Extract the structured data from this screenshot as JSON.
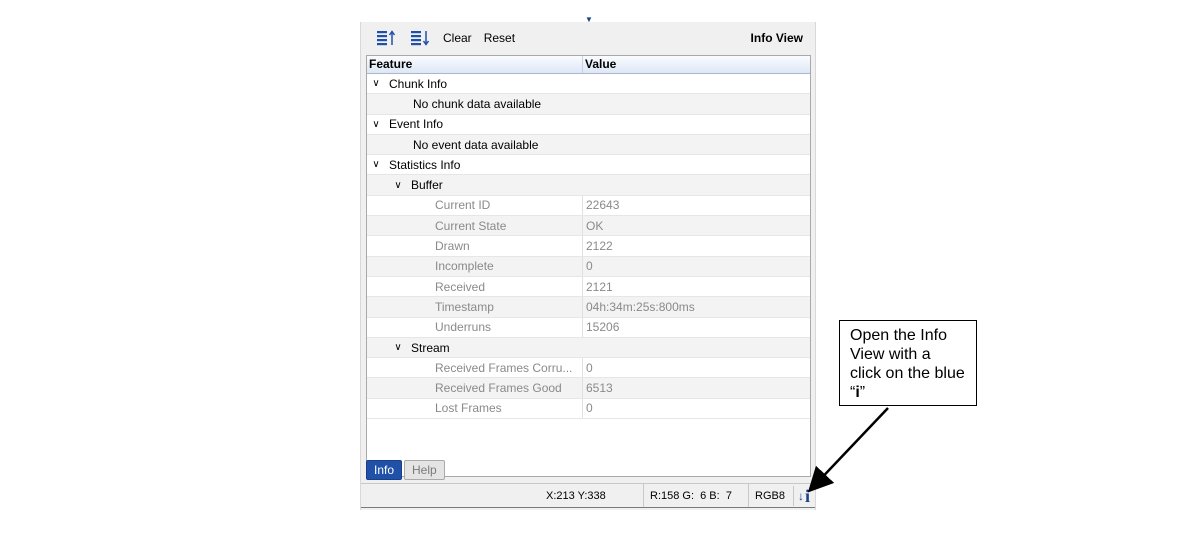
{
  "toolbar": {
    "icon_up": "sort-up-list-icon",
    "icon_down": "sort-down-list-icon",
    "clear_label": "Clear",
    "reset_label": "Reset",
    "title": "Info View"
  },
  "grid": {
    "col_feature": "Feature",
    "col_value": "Value",
    "rows": [
      {
        "feature": "Chunk Info",
        "value": "",
        "level": 0,
        "expand": true
      },
      {
        "feature": "No chunk data available",
        "value": "",
        "level": 1,
        "expand": false
      },
      {
        "feature": "Event Info",
        "value": "",
        "level": 0,
        "expand": true
      },
      {
        "feature": "No event data available",
        "value": "",
        "level": 1,
        "expand": false
      },
      {
        "feature": "Statistics Info",
        "value": "",
        "level": 0,
        "expand": true
      },
      {
        "feature": "Buffer",
        "value": "",
        "level": 1,
        "expand": true
      },
      {
        "feature": "Current ID",
        "value": "22643",
        "level": 2,
        "expand": false
      },
      {
        "feature": "Current State",
        "value": "OK",
        "level": 2,
        "expand": false
      },
      {
        "feature": "Drawn",
        "value": "2122",
        "level": 2,
        "expand": false
      },
      {
        "feature": "Incomplete",
        "value": "0",
        "level": 2,
        "expand": false
      },
      {
        "feature": "Received",
        "value": "2121",
        "level": 2,
        "expand": false
      },
      {
        "feature": "Timestamp",
        "value": "04h:34m:25s:800ms",
        "level": 2,
        "expand": false
      },
      {
        "feature": "Underruns",
        "value": "15206",
        "level": 2,
        "expand": false
      },
      {
        "feature": "Stream",
        "value": "",
        "level": 1,
        "expand": true
      },
      {
        "feature": "Received Frames Corru...",
        "value": "0",
        "level": 2,
        "expand": false
      },
      {
        "feature": "Received Frames Good",
        "value": "6513",
        "level": 2,
        "expand": false
      },
      {
        "feature": "Lost Frames",
        "value": "0",
        "level": 2,
        "expand": false
      }
    ]
  },
  "tabs": [
    {
      "label": "Info",
      "active": true
    },
    {
      "label": "Help",
      "active": false
    }
  ],
  "status": {
    "coords": "X:213 Y:338",
    "rgb": "R:158 G:  6 B:  7",
    "format": "RGB8",
    "info_icon": "info-i-icon"
  },
  "callout": {
    "text_before": "Open the Info View with a click on the blue “",
    "text_bold": "i",
    "text_after": "”"
  },
  "colors": {
    "accent_blue": "#2051a8",
    "info_blue": "#1f3f8a"
  }
}
